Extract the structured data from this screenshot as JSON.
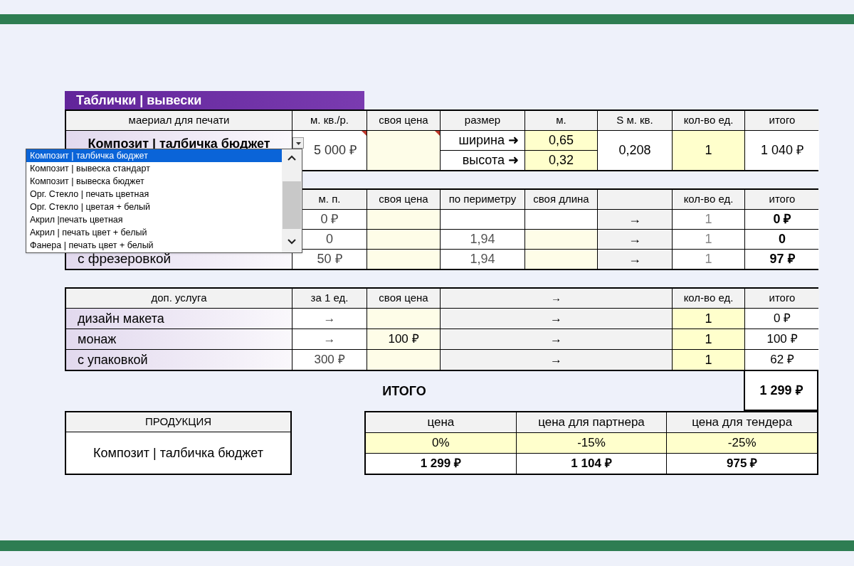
{
  "sign_table": {
    "title": "Таблички | вывески",
    "columns": [
      "маериал для печати",
      "м. кв./р.",
      "своя цена",
      "размер",
      "м.",
      "S м. кв.",
      "кол-во ед.",
      "итого"
    ],
    "material": "Композит | талбичка бюджет",
    "price": "5 000 ₽",
    "size_rows": [
      {
        "label": "ширина ➜",
        "value": "0,65"
      },
      {
        "label": "высота ➜",
        "value": "0,32"
      }
    ],
    "area": "0,208",
    "quantity": "1",
    "total": "1 040 ₽"
  },
  "dropdown": {
    "items": [
      {
        "label": "Композит | талбичка бюджет",
        "selected": true
      },
      {
        "label": "Композит | вывеска стандарт",
        "selected": false
      },
      {
        "label": "Композит | вывеска бюджет",
        "selected": false
      },
      {
        "label": "Орг. Стекло | печать цветная",
        "selected": false
      },
      {
        "label": "Орг. Стекло | цветая + белый",
        "selected": false
      },
      {
        "label": "Акрил |печать цветная",
        "selected": false
      },
      {
        "label": "Акрил | печать цвет + белый",
        "selected": false
      },
      {
        "label": "Фанера | печать цвет + белый",
        "selected": false
      }
    ]
  },
  "edging_table": {
    "columns": [
      "м. п.",
      "своя цена",
      "по периметру",
      "своя длина",
      "кол-во ед.",
      "итого"
    ],
    "rows": [
      {
        "rate": "0 ₽",
        "arrow": "→",
        "quantity": "1",
        "total": "0 ₽"
      },
      {
        "rate": "0",
        "perimeter": "1,94",
        "arrow": "→",
        "quantity": "1",
        "total": "0"
      },
      {
        "name": "с фрезеровкой",
        "rate": "50 ₽",
        "perimeter": "1,94",
        "arrow": "→",
        "quantity": "1",
        "total": "97 ₽"
      }
    ]
  },
  "services_table": {
    "columns": [
      "доп. услуга",
      "за 1 ед.",
      "своя цена",
      "→",
      "кол-во ед.",
      "итого"
    ],
    "rows": [
      {
        "name": "дизайн макета",
        "unit_price": "→",
        "arrow": "→",
        "quantity": "1",
        "total": "0 ₽"
      },
      {
        "name": "монаж",
        "unit_price": "→",
        "own_price": "100 ₽",
        "arrow": "→",
        "quantity": "1",
        "total": "100 ₽"
      },
      {
        "name": "с упаковкой",
        "unit_price": "300 ₽",
        "arrow": "→",
        "quantity": "1",
        "total": "62 ₽"
      }
    ]
  },
  "grand_total": {
    "label": "ИТОГО",
    "value": "1 299 ₽"
  },
  "product": {
    "header": "ПРОДУКЦИЯ",
    "value": "Композит | талбичка бюджет"
  },
  "prices": {
    "columns": [
      {
        "label": "цена",
        "discount": "0%",
        "price": "1 299 ₽"
      },
      {
        "label": "цена для партнера",
        "discount": "-15%",
        "price": "1 104 ₽"
      },
      {
        "label": "цена для тендера",
        "discount": "-25%",
        "price": "975 ₽"
      }
    ]
  }
}
